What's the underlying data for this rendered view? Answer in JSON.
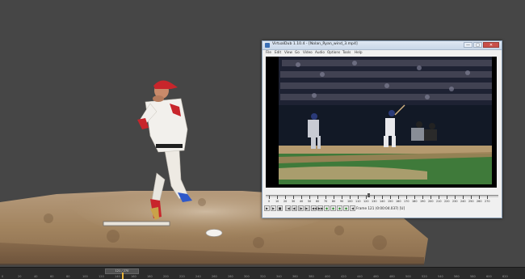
{
  "virtualdub": {
    "title": "VirtualDub 1.10.4 - [Nolan_Ryan_wind_3.mp4]",
    "menu": [
      "File",
      "Edit",
      "View",
      "Go",
      "Video",
      "Audio",
      "Options",
      "Tools",
      "Help"
    ],
    "window_buttons": {
      "minimize": "—",
      "maximize": "□",
      "close": "✕"
    },
    "ruler_labels": [
      "0",
      "10",
      "20",
      "30",
      "40",
      "50",
      "60",
      "70",
      "80",
      "90",
      "100",
      "110",
      "120",
      "130",
      "140",
      "150",
      "160",
      "170",
      "180",
      "190",
      "200",
      "210",
      "220",
      "230",
      "240",
      "250",
      "260",
      "270"
    ],
    "frame_readout": "Frame 121 (0:00:04.037) [U]",
    "playback_buttons": [
      "▶",
      "▶",
      "■",
      "|◀",
      "◀|",
      "|▶",
      "▶|",
      "◀◀",
      "▶▶",
      "◆",
      "◆",
      "◆",
      "◆",
      "◀",
      "▶"
    ]
  },
  "timeline": {
    "current_frame": "121 / 270",
    "labels": [
      "0",
      "20",
      "40",
      "60",
      "80",
      "100",
      "120",
      "140",
      "160",
      "180",
      "200",
      "220",
      "240",
      "260",
      "280",
      "300",
      "320",
      "340",
      "360",
      "380",
      "400",
      "420",
      "440",
      "460",
      "480",
      "500",
      "520",
      "540",
      "560",
      "580",
      "600",
      "620"
    ]
  },
  "colors": {
    "viewport_bg": "#464646",
    "mound": "#a98b6c",
    "jersey": "#f1efea",
    "cap": "#c8252b",
    "field_grass": "#3f7a3a",
    "window_title_bg": "#c9d7e8"
  }
}
